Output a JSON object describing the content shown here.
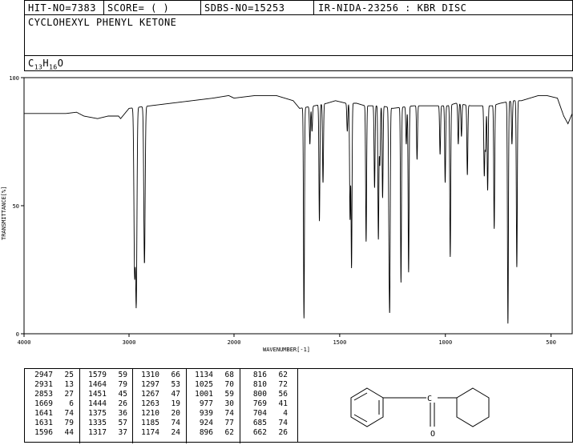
{
  "header": {
    "hit_no": "HIT-NO=7383",
    "score": "SCORE=  (   )",
    "sdbs_no": "SDBS-NO=15253",
    "ir_nida": "IR-NIDA-23256 : KBR DISC",
    "compound_name": "CYCLOHEXYL PHENYL KETONE",
    "formula": {
      "c": "C",
      "c_n": "13",
      "h": "H",
      "h_n": "16",
      "o": "O"
    }
  },
  "chart_data": {
    "type": "line",
    "xlabel": "WAVENUMBER[-1]",
    "ylabel": "TRANSMITTANCE[%]",
    "xlim": [
      4000,
      400
    ],
    "ylim": [
      0,
      100
    ],
    "x_ticks": [
      4000,
      3000,
      2000,
      1500,
      1000,
      500
    ],
    "y_ticks": [
      100,
      50,
      0
    ],
    "grid": false,
    "baseline": [
      [
        4000,
        86
      ],
      [
        3800,
        86
      ],
      [
        3600,
        86
      ],
      [
        3500,
        86.5
      ],
      [
        3430,
        85
      ],
      [
        3300,
        84
      ],
      [
        3200,
        85
      ],
      [
        3100,
        85
      ],
      [
        3080,
        84
      ],
      [
        3060,
        85
      ],
      [
        3000,
        88
      ],
      [
        2600,
        90
      ],
      [
        2400,
        91
      ],
      [
        2200,
        92
      ],
      [
        2050,
        93
      ],
      [
        2000,
        92
      ],
      [
        1900,
        93
      ],
      [
        1800,
        93
      ],
      [
        1760,
        92
      ],
      [
        1720,
        91
      ],
      [
        1690,
        88
      ],
      [
        1620,
        89
      ],
      [
        1560,
        90
      ],
      [
        1520,
        91
      ],
      [
        1470,
        90
      ],
      [
        1420,
        90
      ],
      [
        1380,
        89
      ],
      [
        1300,
        89
      ],
      [
        1250,
        88
      ],
      [
        1150,
        89
      ],
      [
        1050,
        89
      ],
      [
        990,
        89
      ],
      [
        950,
        90
      ],
      [
        880,
        89
      ],
      [
        820,
        89
      ],
      [
        780,
        89
      ],
      [
        740,
        90
      ],
      [
        680,
        91
      ],
      [
        640,
        91
      ],
      [
        600,
        92
      ],
      [
        560,
        93
      ],
      [
        520,
        93
      ],
      [
        470,
        92
      ],
      [
        440,
        85
      ],
      [
        420,
        82
      ],
      [
        400,
        86
      ]
    ],
    "peaks": [
      {
        "wn": 2947,
        "t": 25
      },
      {
        "wn": 2931,
        "t": 13
      },
      {
        "wn": 2853,
        "t": 27
      },
      {
        "wn": 1669,
        "t": 6
      },
      {
        "wn": 1641,
        "t": 74
      },
      {
        "wn": 1631,
        "t": 79
      },
      {
        "wn": 1596,
        "t": 44
      },
      {
        "wn": 1579,
        "t": 59
      },
      {
        "wn": 1464,
        "t": 79
      },
      {
        "wn": 1451,
        "t": 45
      },
      {
        "wn": 1444,
        "t": 26
      },
      {
        "wn": 1375,
        "t": 36
      },
      {
        "wn": 1335,
        "t": 57
      },
      {
        "wn": 1317,
        "t": 37
      },
      {
        "wn": 1310,
        "t": 66
      },
      {
        "wn": 1297,
        "t": 53
      },
      {
        "wn": 1267,
        "t": 47
      },
      {
        "wn": 1263,
        "t": 19
      },
      {
        "wn": 1210,
        "t": 20
      },
      {
        "wn": 1185,
        "t": 74
      },
      {
        "wn": 1174,
        "t": 24
      },
      {
        "wn": 1134,
        "t": 68
      },
      {
        "wn": 1025,
        "t": 70
      },
      {
        "wn": 1001,
        "t": 59
      },
      {
        "wn": 977,
        "t": 30
      },
      {
        "wn": 939,
        "t": 74
      },
      {
        "wn": 924,
        "t": 77
      },
      {
        "wn": 896,
        "t": 62
      },
      {
        "wn": 816,
        "t": 62
      },
      {
        "wn": 810,
        "t": 72
      },
      {
        "wn": 800,
        "t": 56
      },
      {
        "wn": 769,
        "t": 41
      },
      {
        "wn": 704,
        "t": 4
      },
      {
        "wn": 685,
        "t": 74
      },
      {
        "wn": 662,
        "t": 26
      }
    ]
  },
  "peak_table": {
    "columns": [
      [
        [
          "2947",
          "25"
        ],
        [
          "2931",
          "13"
        ],
        [
          "2853",
          "27"
        ],
        [
          "1669",
          "6"
        ],
        [
          "1641",
          "74"
        ],
        [
          "1631",
          "79"
        ],
        [
          "1596",
          "44"
        ]
      ],
      [
        [
          "1579",
          "59"
        ],
        [
          "1464",
          "79"
        ],
        [
          "1451",
          "45"
        ],
        [
          "1444",
          "26"
        ],
        [
          "1375",
          "36"
        ],
        [
          "1335",
          "57"
        ],
        [
          "1317",
          "37"
        ]
      ],
      [
        [
          "1310",
          "66"
        ],
        [
          "1297",
          "53"
        ],
        [
          "1267",
          "47"
        ],
        [
          "1263",
          "19"
        ],
        [
          "1210",
          "20"
        ],
        [
          "1185",
          "74"
        ],
        [
          "1174",
          "24"
        ]
      ],
      [
        [
          "1134",
          "68"
        ],
        [
          "1025",
          "70"
        ],
        [
          "1001",
          "59"
        ],
        [
          "977",
          "30"
        ],
        [
          "939",
          "74"
        ],
        [
          "924",
          "77"
        ],
        [
          "896",
          "62"
        ]
      ],
      [
        [
          "816",
          "62"
        ],
        [
          "810",
          "72"
        ],
        [
          "800",
          "56"
        ],
        [
          "769",
          "41"
        ],
        [
          "704",
          "4"
        ],
        [
          "685",
          "74"
        ],
        [
          "662",
          "26"
        ]
      ]
    ]
  },
  "structure": {
    "oxygen_label": "O",
    "carbon_label": "C"
  }
}
